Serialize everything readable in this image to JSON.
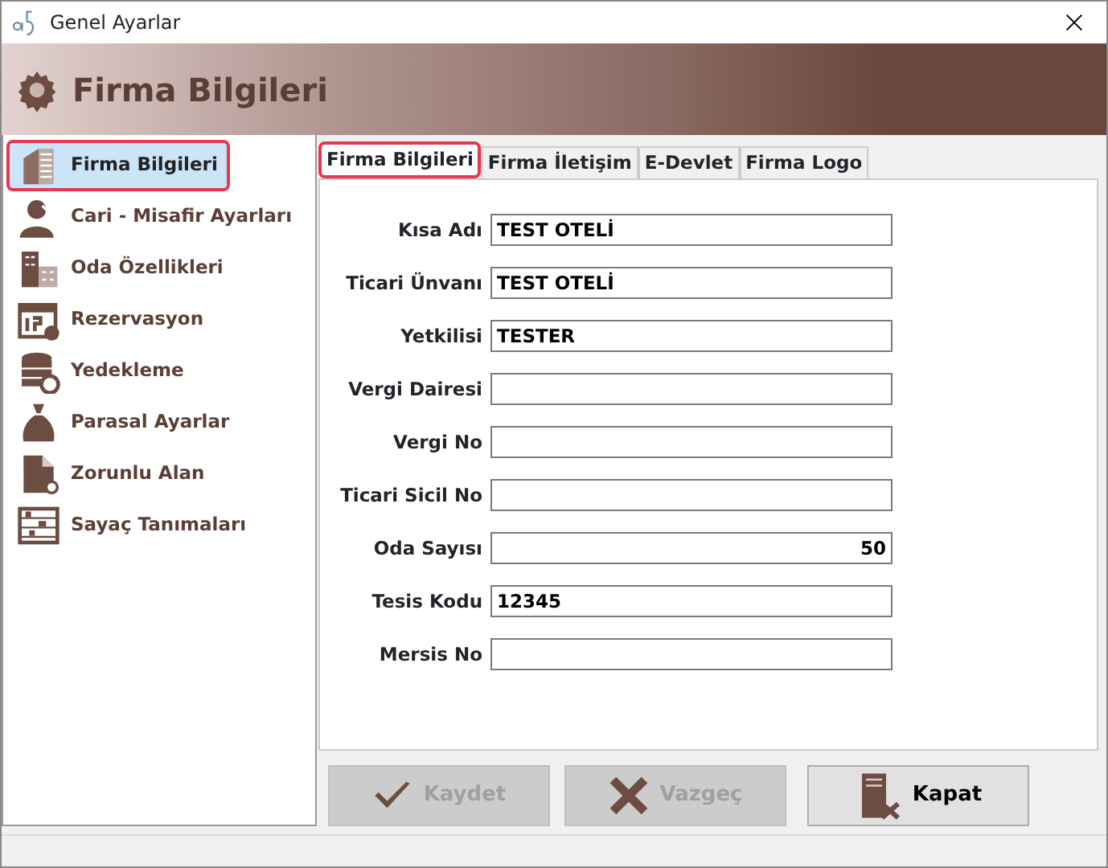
{
  "window": {
    "title": "Genel Ayarlar"
  },
  "header": {
    "title": "Firma Bilgileri"
  },
  "sidebar": {
    "items": [
      {
        "label": "Firma Bilgileri",
        "selected": true
      },
      {
        "label": "Cari - Misafir Ayarları",
        "selected": false
      },
      {
        "label": "Oda Özellikleri",
        "selected": false
      },
      {
        "label": "Rezervasyon",
        "selected": false
      },
      {
        "label": "Yedekleme",
        "selected": false
      },
      {
        "label": "Parasal Ayarlar",
        "selected": false
      },
      {
        "label": "Zorunlu Alan",
        "selected": false
      },
      {
        "label": "Sayaç Tanımaları",
        "selected": false
      }
    ]
  },
  "tabs": [
    {
      "label": "Firma Bilgileri",
      "selected": true
    },
    {
      "label": "Firma İletişim",
      "selected": false
    },
    {
      "label": "E-Devlet",
      "selected": false
    },
    {
      "label": "Firma Logo",
      "selected": false
    }
  ],
  "form": {
    "fields": [
      {
        "label": "Kısa Adı",
        "value": "TEST OTELİ",
        "kind": "text"
      },
      {
        "label": "Ticari Ünvanı",
        "value": "TEST OTELİ",
        "kind": "text"
      },
      {
        "label": "Yetkilisi",
        "value": "TESTER",
        "kind": "text"
      },
      {
        "label": "Vergi Dairesi",
        "kind": "text"
      },
      {
        "label": "Vergi No",
        "kind": "text"
      },
      {
        "label": "Ticari Sicil No",
        "kind": "text"
      },
      {
        "label": "Oda Sayısı",
        "value": "50",
        "kind": "number"
      },
      {
        "label": "Tesis Kodu",
        "value": "12345",
        "kind": "text"
      },
      {
        "label": "Mersis No",
        "kind": "text"
      }
    ]
  },
  "buttons": [
    {
      "label": "Kaydet",
      "disabled": true
    },
    {
      "label": "Vazgeç",
      "disabled": true
    },
    {
      "label": "Kapat",
      "disabled": false
    }
  ]
}
